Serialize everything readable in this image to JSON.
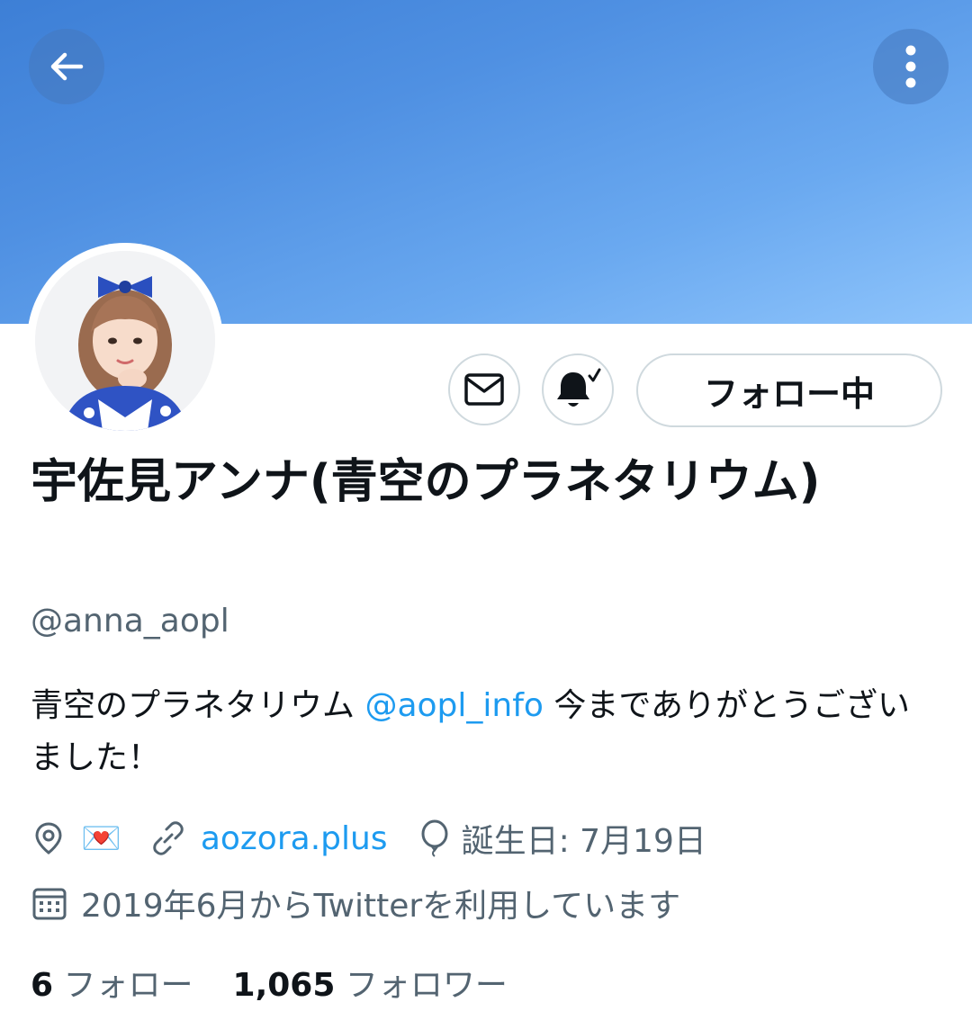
{
  "header": {
    "back_icon": "arrow-left-icon",
    "more_icon": "vertical-dots-icon"
  },
  "profile": {
    "display_name": "宇佐見アンナ(青空のプラネタリウム)",
    "handle": "@anna_aopl",
    "bio_text_1": "青空のプラネタリウム ",
    "bio_mention": "@aopl_info",
    "bio_text_2": " 今までありがとうございました！",
    "location_emoji": "💌",
    "website": "aozora.plus",
    "birthday": "誕生日: 7月19日",
    "joined": "2019年6月からTwitterを利用しています"
  },
  "actions": {
    "message_icon": "envelope-icon",
    "notify_icon": "bell-check-icon",
    "follow_label": "フォロー中"
  },
  "stats": {
    "following_count": "6",
    "following_label": "フォロー",
    "followers_count": "1,065",
    "followers_label": "フォロワー"
  },
  "colors": {
    "accent": "#1d9bf0",
    "secondary_text": "#536471",
    "banner": "#4f90e2"
  }
}
